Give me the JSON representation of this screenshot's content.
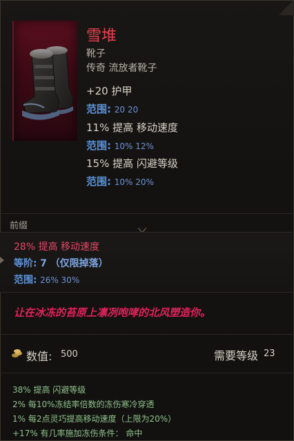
{
  "item": {
    "name": "雪堆",
    "type": "靴子",
    "rarity_line": "传奇 流放者靴子",
    "base_stats": [
      {
        "text": "+20 护甲",
        "range_label": "范围:",
        "range": "20  20"
      },
      {
        "text": "11% 提高 移动速度",
        "range_label": "范围:",
        "range": "10%  12%"
      },
      {
        "text": "15% 提高 闪避等级",
        "range_label": "范围:",
        "range": "10%  20%"
      }
    ]
  },
  "affix": {
    "section_label": "前缀",
    "line": "28% 提高 移动速度",
    "tier_label": "等阶:",
    "tier_value": "7  （仅限掉落）",
    "range_label": "范围:",
    "range": "26%  30%"
  },
  "flavor_text": "让在冰冻的苔原上凛冽咆哮的北风塑造你。",
  "footer": {
    "value_label": "数值:",
    "value": "500",
    "level_label": "需要等级",
    "level_value": "23"
  },
  "unique_mods": [
    "38% 提高 闪避等级",
    "2% 每10%冻结率倍数的冻伤寒冷穿透",
    "1% 每2点灵巧提高移动速度（上限为20%）",
    "+17% 有几率施加冻伤条件：  命中"
  ],
  "colors": {
    "title": "#e8404f",
    "range_blue": "#5b92d8",
    "affix_red": "#e34766",
    "flavor": "#e0225a",
    "mods_green": "#8fc28a"
  },
  "icons": [
    "boots-icon",
    "coin-icon"
  ]
}
